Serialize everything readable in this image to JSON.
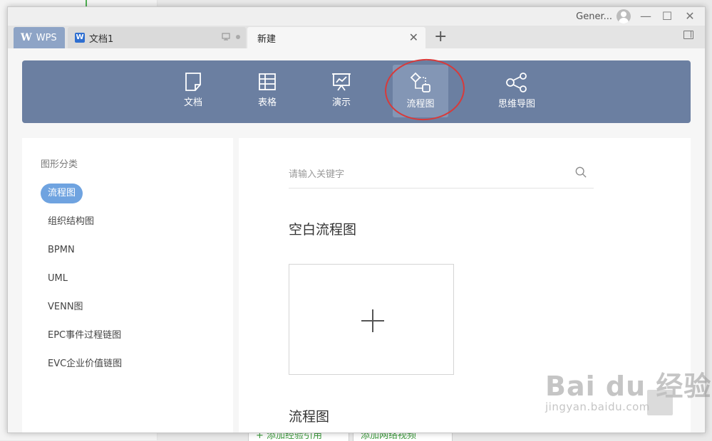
{
  "window": {
    "user_name": "Gener...",
    "controls": {
      "minimize": "—",
      "maximize": "☐",
      "close": "✕"
    }
  },
  "tabs": {
    "wps": {
      "logo": "W",
      "label": "WPS"
    },
    "doc": {
      "icon": "W",
      "label": "文档1"
    },
    "new": {
      "label": "新建",
      "close": "✕"
    },
    "add": "+"
  },
  "types": [
    {
      "label": "文档",
      "icon": "document-icon"
    },
    {
      "label": "表格",
      "icon": "table-icon"
    },
    {
      "label": "演示",
      "icon": "presentation-icon"
    },
    {
      "label": "流程图",
      "icon": "flowchart-icon",
      "active": true
    },
    {
      "label": "思维导图",
      "icon": "mindmap-icon"
    }
  ],
  "categories": {
    "title": "图形分类",
    "items": [
      "流程图",
      "组织结构图",
      "BPMN",
      "UML",
      "VENN图",
      "EPC事件过程链图",
      "EVC企业价值链图"
    ],
    "active": "流程图"
  },
  "content": {
    "search_placeholder": "请输入关键字",
    "blank_title": "空白流程图",
    "section2_title": "流程图"
  },
  "background": {
    "btn1": "+ 添加经验引用",
    "btn2": "添加网络视频"
  },
  "watermark": {
    "main": "Bai du 经验",
    "sub": "jingyan.baidu.com"
  },
  "colors": {
    "typebar": "#6b7fa1",
    "active_category": "#6fa3e0",
    "highlight_ring": "#d83a3a",
    "wps_tab": "#8ea4c6"
  }
}
